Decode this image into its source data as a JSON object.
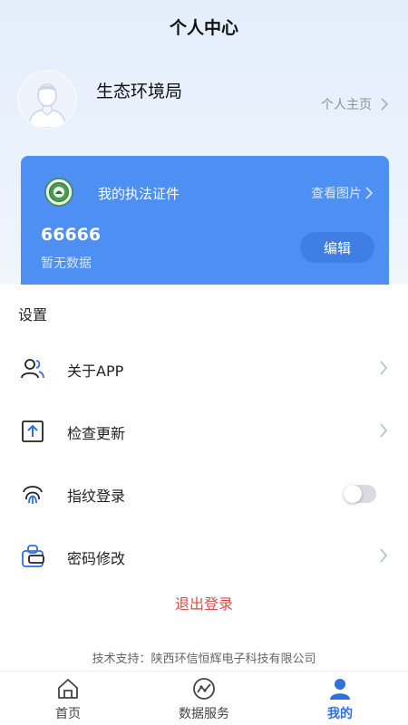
{
  "header": {
    "title": "个人中心"
  },
  "profile": {
    "org_name": "生态环境局",
    "homepage_label": "个人主页"
  },
  "certificate_card": {
    "title": "我的执法证件",
    "view_pictures": "查看图片",
    "number": "66666",
    "status": "暂无数据",
    "edit_label": "编辑",
    "color": "#4d8ff2"
  },
  "settings": {
    "heading": "设置",
    "items": [
      {
        "label": "关于APP",
        "icon": "users-icon",
        "control": "chevron"
      },
      {
        "label": "检查更新",
        "icon": "upload-box-icon",
        "control": "chevron"
      },
      {
        "label": "指纹登录",
        "icon": "fingerprint-icon",
        "control": "toggle",
        "enabled": false
      },
      {
        "label": "密码修改",
        "icon": "lock-card-icon",
        "control": "chevron"
      }
    ],
    "logout_label": "退出登录",
    "logout_color": "#e04a4a"
  },
  "footer": {
    "support_text": "技术支持：陕西环信恒辉电子科技有限公司"
  },
  "tabbar": {
    "tabs": [
      {
        "label": "首页",
        "icon": "home-icon",
        "active": false
      },
      {
        "label": "数据服务",
        "icon": "chart-circle-icon",
        "active": false
      },
      {
        "label": "我的",
        "icon": "user-icon",
        "active": true
      }
    ],
    "active_color": "#2f6fe0"
  }
}
